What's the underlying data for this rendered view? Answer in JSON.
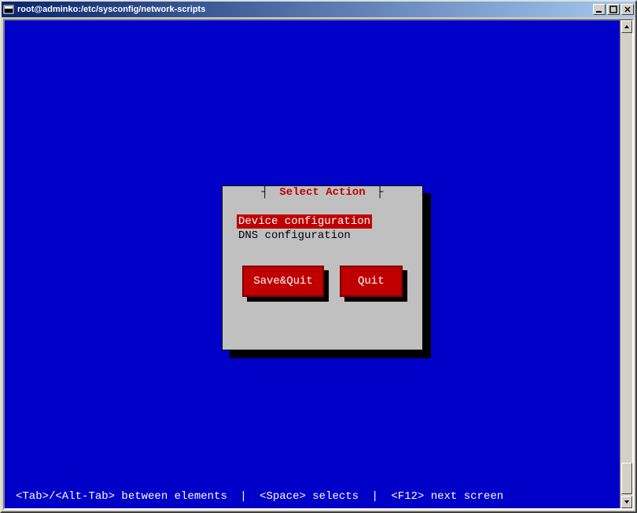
{
  "window": {
    "title": "root@adminko:/etc/sysconfig/network-scripts"
  },
  "dialog": {
    "title": "Select Action",
    "items": [
      {
        "label": "Device configuration",
        "selected": true
      },
      {
        "label": "DNS configuration",
        "selected": false
      }
    ],
    "buttons": {
      "save_quit": "Save&Quit",
      "quit": "Quit"
    }
  },
  "footer": {
    "tab_hint": "<Tab>/<Alt-Tab> between elements",
    "space_hint": "<Space> selects",
    "f12_hint": "<F12> next screen",
    "sep": "|"
  }
}
